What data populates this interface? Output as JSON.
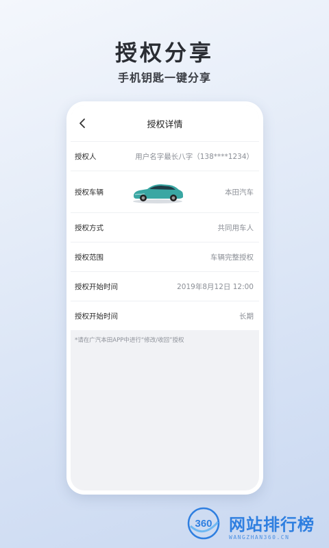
{
  "hero": {
    "title": "授权分享",
    "subtitle": "手机钥匙一键分享"
  },
  "nav": {
    "title": "授权详情",
    "back_icon": "chevron-left-icon"
  },
  "details": [
    {
      "label": "授权人",
      "value": "用户名字最长八字（138****1234）"
    },
    {
      "label": "授权车辆",
      "value": "本田汽车",
      "image": "car-image"
    },
    {
      "label": "授权方式",
      "value": "共同用车人"
    },
    {
      "label": "授权范围",
      "value": "车辆完整授权"
    },
    {
      "label": "授权开始时间",
      "value": "2019年8月12日 12:00"
    },
    {
      "label": "授权开始时间",
      "value": "长期"
    }
  ],
  "note": "*请在广汽本田APP中进行“修改/收回”授权",
  "watermark": {
    "logo_text": "360",
    "text": "网站排行榜",
    "url": "WANGZHAN360.CN"
  },
  "colors": {
    "accent": "#2f7fe0",
    "car_body": "#3aa7a3"
  }
}
